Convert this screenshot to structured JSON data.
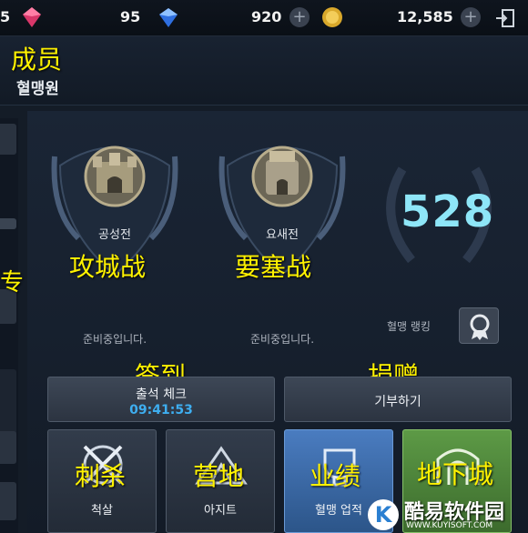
{
  "resources": {
    "ruby_count_partial": "5",
    "crystal_count": "95",
    "diamond_count": "920",
    "gold_count": "12,585"
  },
  "header": {
    "title_cn": "成员",
    "title_kr": "혈맹원"
  },
  "side": {
    "partial_cn": "专"
  },
  "battles": [
    {
      "name_kr": "공성전",
      "name_cn": "攻城战",
      "status": "준비중입니다."
    },
    {
      "name_kr": "요새전",
      "name_cn": "要塞战",
      "status": "준비중입니다."
    }
  ],
  "ranking": {
    "value": "528",
    "label": "혈맹 랭킹"
  },
  "checkin": {
    "label_cn": "签到",
    "label_kr": "출석 체크",
    "timer": "09:41:53"
  },
  "donate": {
    "label_cn": "捐赠",
    "label_kr": "기부하기"
  },
  "tiles": [
    {
      "label_cn": "刺杀",
      "label_kr": "척살"
    },
    {
      "label_cn": "营地",
      "label_kr": "아지트"
    },
    {
      "label_cn": "业绩",
      "label_kr": "혈맹 업적"
    },
    {
      "label_cn": "地下城",
      "label_kr": ""
    }
  ],
  "watermark": {
    "name": "酷易软件园",
    "url": "WWW.KUYISOFT.COM",
    "logo_letter": "K"
  },
  "colors": {
    "accent_cyan": "#8ee6f8",
    "timer_blue": "#3eaef0",
    "overlay_yellow": "#fff200",
    "achievement_tile": "#3a6aa8",
    "dungeon_tile": "#4f8a3a"
  }
}
